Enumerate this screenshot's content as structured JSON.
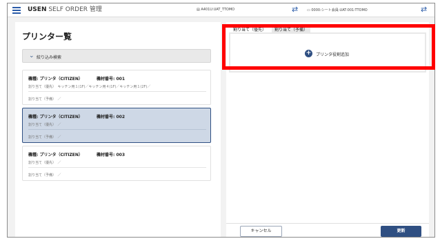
{
  "header": {
    "brand_bold": "USEN",
    "brand_rest": " SELF ORDER 管理",
    "store": "A401U:UAT_TTOMO",
    "terminal": "0000:シート会員-UAT-001-TTOMO"
  },
  "left": {
    "title": "プリンター覧",
    "filter_label": "絞り込み検索",
    "printers": [
      {
        "name": "機種: プリンタ（CITIZEN）",
        "number": "機材番号: 001",
        "primary": "割り当て（優先）　キッチン用１(1F)／キッチン用４(1F)／キッチン用１(2F)／",
        "backup": "割り当て（予備）　／",
        "selected": false
      },
      {
        "name": "機種: プリンタ（CITIZEN）",
        "number": "機材番号: 002",
        "primary": "割り当て（優先）　／",
        "backup": "割り当て（予備）　／",
        "selected": true
      },
      {
        "name": "機種: プリンタ（CITIZEN）",
        "number": "機材番号: 003",
        "primary": "割り当て（優先）　／",
        "backup": "割り当て（予備）　／",
        "selected": false
      }
    ]
  },
  "right": {
    "tabs": [
      {
        "label": "割り当て（優先）"
      },
      {
        "label": "割り当て（予備）"
      }
    ],
    "add_label": "プリンタ役割追加",
    "cancel_label": "キャンセル",
    "update_label": "更新"
  },
  "colors": {
    "accent": "#2f4f82",
    "selected_bg": "#ced8e6",
    "highlight": "#ff0000"
  }
}
